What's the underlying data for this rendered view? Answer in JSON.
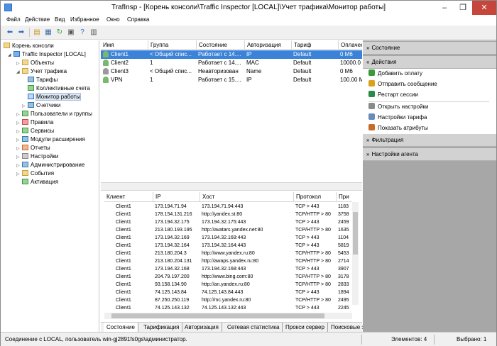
{
  "window": {
    "title": "TrafInsp - [Корень консоли\\Traffic Inspector [LOCAL]\\Учет трафика\\Монитор работы]",
    "minimize": "–",
    "maximize": "❐",
    "close": "✕"
  },
  "menu": [
    "Файл",
    "Действие",
    "Вид",
    "Избранное",
    "Окно",
    "Справка"
  ],
  "tree": {
    "root": "Корень консоли",
    "items": [
      {
        "label": "Traffic Inspector [LOCAL]",
        "toggle": "◢"
      },
      {
        "label": "Объекты",
        "toggle": "▷"
      },
      {
        "label": "Учет трафика",
        "toggle": "◢"
      },
      {
        "label": "Тарифы",
        "toggle": ""
      },
      {
        "label": "Коллективные счета",
        "toggle": ""
      },
      {
        "label": "Монитор работы",
        "toggle": ""
      },
      {
        "label": "Счетчики",
        "toggle": "▷"
      },
      {
        "label": "Пользователи и группы",
        "toggle": "▷"
      },
      {
        "label": "Правила",
        "toggle": "▷"
      },
      {
        "label": "Сервисы",
        "toggle": "▷"
      },
      {
        "label": "Модули расширения",
        "toggle": "▷"
      },
      {
        "label": "Отчеты",
        "toggle": "▷"
      },
      {
        "label": "Настройки",
        "toggle": "▷"
      },
      {
        "label": "Администрирование",
        "toggle": "▷"
      },
      {
        "label": "События",
        "toggle": "▷"
      },
      {
        "label": "Активация",
        "toggle": ""
      }
    ]
  },
  "clients": {
    "columns": [
      "Имя",
      "Группа",
      "Состояние",
      "Авторизация",
      "Тариф",
      "Оплачено"
    ],
    "rows": [
      {
        "name": "Client1",
        "group": "< Общий спис...",
        "state": "Работает с 14....",
        "auth": "IP",
        "tariff": "Default",
        "paid": "0 М6"
      },
      {
        "name": "Client2",
        "group": "1",
        "state": "Работает с 14....",
        "auth": "MAC",
        "tariff": "Default",
        "paid": "10000.0"
      },
      {
        "name": "Client3",
        "group": "< Общий спис...",
        "state": "Неавторизован",
        "auth": "Name",
        "tariff": "Default",
        "paid": "0 М6"
      },
      {
        "name": "VPN",
        "group": "1",
        "state": "Работает с 15....",
        "auth": "IP",
        "tariff": "Default",
        "paid": "100.00 М"
      }
    ]
  },
  "connections": {
    "columns": [
      "Клиент",
      "IP",
      "Хост",
      "Протокол",
      "При"
    ],
    "rows": [
      {
        "client": "Client1",
        "ip": "173.194.71.94",
        "host": "173.194.71.94:443",
        "proto": "TCP > 443",
        "port": "1183"
      },
      {
        "client": "Client1",
        "ip": "178.154.131.216",
        "host": "http://yandex.st:80",
        "proto": "TCP/HTTP > 80",
        "port": "3758"
      },
      {
        "client": "Client1",
        "ip": "173.194.32.175",
        "host": "173.194.32.175:443",
        "proto": "TCP > 443",
        "port": "2459"
      },
      {
        "client": "Client1",
        "ip": "213.180.193.195",
        "host": "http://avatars.yandex.net:80",
        "proto": "TCP/HTTP > 80",
        "port": "1635"
      },
      {
        "client": "Client1",
        "ip": "173.194.32.169",
        "host": "173.194.32.169:443",
        "proto": "TCP > 443",
        "port": "1104"
      },
      {
        "client": "Client1",
        "ip": "173.194.32.164",
        "host": "173.194.32.164:443",
        "proto": "TCP > 443",
        "port": "5819"
      },
      {
        "client": "Client1",
        "ip": "213.180.204.3",
        "host": "http://www.yandex.ru:80",
        "proto": "TCP/HTTP > 80",
        "port": "5453"
      },
      {
        "client": "Client1",
        "ip": "213.180.204.131",
        "host": "http://awaps.yandex.ru:80",
        "proto": "TCP/HTTP > 80",
        "port": "2714"
      },
      {
        "client": "Client1",
        "ip": "173.194.32.168",
        "host": "173.194.32.168:443",
        "proto": "TCP > 443",
        "port": "3907"
      },
      {
        "client": "Client1",
        "ip": "204.79.197.200",
        "host": "http://www.bing.com:80",
        "proto": "TCP/HTTP > 80",
        "port": "3178"
      },
      {
        "client": "Client1",
        "ip": "93.158.134.90",
        "host": "http://an.yandex.ru:80",
        "proto": "TCP/HTTP > 80",
        "port": "2833"
      },
      {
        "client": "Client1",
        "ip": "74.125.143.84",
        "host": "74.125.143.84:443",
        "proto": "TCP > 443",
        "port": "1894"
      },
      {
        "client": "Client1",
        "ip": "87.250.250.119",
        "host": "http://mc.yandex.ru:80",
        "proto": "TCP/HTTP > 80",
        "port": "2495"
      },
      {
        "client": "Client1",
        "ip": "74.125.143.132",
        "host": "74.125.143.132:443",
        "proto": "TCP > 443",
        "port": "2245"
      }
    ]
  },
  "tabs": [
    "Состояние",
    "Тарификация",
    "Авторизация",
    "Сетевая статистика",
    "Прокси сервер",
    "Поисковые запросы"
  ],
  "actions_pane": {
    "sections": [
      "Состояние",
      "Действия",
      "Фильтрация",
      "Настройки агента"
    ],
    "items": [
      {
        "label": "Добавить оплату",
        "icon": "add-payment-icon",
        "color": "#3a9a3a"
      },
      {
        "label": "Отправить сообщение",
        "icon": "message-icon",
        "color": "#d9a21c"
      },
      {
        "label": "Рестарт сессии",
        "icon": "restart-icon",
        "color": "#2a8a4a"
      },
      {
        "label": "Открыть настройки",
        "icon": "settings-icon",
        "color": "#8a8a8a"
      },
      {
        "label": "Настройки тарифа",
        "icon": "tariff-icon",
        "color": "#6a8ab8"
      },
      {
        "label": "Показать атрибуты",
        "icon": "attributes-icon",
        "color": "#c86a2a"
      }
    ]
  },
  "status": {
    "connection": "Соединение с LOCAL, пользователь win-gj2891fs0gs\\администратор.",
    "elements": "Элементов: 4",
    "selected": "Выбрано: 1"
  },
  "colors": {
    "selection": "#3b83d8",
    "panel_bg": "#a7a7a7",
    "section_bg": "#d2d2d2",
    "close_button": "#c7463c"
  }
}
